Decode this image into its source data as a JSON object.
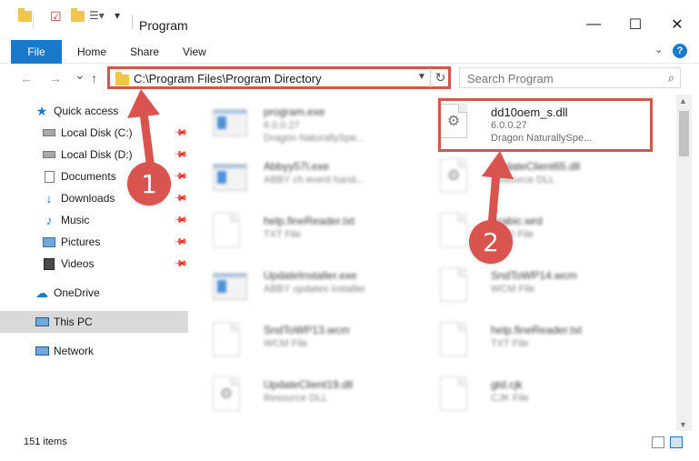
{
  "window": {
    "title": "Program",
    "minimize": "—",
    "maximize": "☐",
    "close": "✕"
  },
  "ribbon": {
    "file": "File",
    "home": "Home",
    "share": "Share",
    "view": "View",
    "help": "?"
  },
  "nav": {
    "back": "←",
    "forward": "→",
    "recent": "⌄",
    "up": "↑",
    "address": "C:\\Program Files\\Program Directory",
    "refresh": "↻",
    "search_placeholder": "Search Program"
  },
  "sidebar": {
    "items": [
      {
        "label": "Quick access",
        "icon": "star-icon",
        "pinned": false
      },
      {
        "label": "Local Disk (C:)",
        "icon": "drive-icon",
        "pinned": true
      },
      {
        "label": "Local Disk (D:)",
        "icon": "drive-icon",
        "pinned": true
      },
      {
        "label": "Documents",
        "icon": "documents-icon",
        "pinned": true
      },
      {
        "label": "Downloads",
        "icon": "download-icon",
        "pinned": true
      },
      {
        "label": "Music",
        "icon": "music-icon",
        "pinned": true
      },
      {
        "label": "Pictures",
        "icon": "pictures-icon",
        "pinned": true
      },
      {
        "label": "Videos",
        "icon": "videos-icon",
        "pinned": true
      },
      {
        "label": "OneDrive",
        "icon": "cloud-icon",
        "pinned": false
      },
      {
        "label": "This PC",
        "icon": "computer-icon",
        "pinned": false,
        "selected": true
      },
      {
        "label": "Network",
        "icon": "network-icon",
        "pinned": false
      }
    ]
  },
  "files": [
    {
      "name": "program.exe",
      "sub1": "6.0.0.27",
      "sub2": "Dragon NaturallySpe...",
      "kind": "exe",
      "blurred": true
    },
    {
      "name": "dd10oem_s.dll",
      "sub1": "6.0.0.27",
      "sub2": "Dragon NaturallySpe...",
      "kind": "dll",
      "blurred": false,
      "highlighted": true
    },
    {
      "name": "Abbyy57l.exe",
      "sub1": "ABBY ch event hand...",
      "sub2": "",
      "kind": "app",
      "blurred": true
    },
    {
      "name": "UpdateClient65.dll",
      "sub1": "Resource DLL",
      "sub2": "",
      "kind": "dll",
      "blurred": true
    },
    {
      "name": "help.fineReader.txt",
      "sub1": "TXT File",
      "sub2": "",
      "kind": "doc",
      "blurred": true
    },
    {
      "name": "Arabic.wrd",
      "sub1": "WRD File",
      "sub2": "",
      "kind": "doc",
      "blurred": true
    },
    {
      "name": "UpdateInstaller.exe",
      "sub1": "ABBY updates installer",
      "sub2": "",
      "kind": "app",
      "blurred": true
    },
    {
      "name": "SndToWP14.wcm",
      "sub1": "WCM File",
      "sub2": "",
      "kind": "doc",
      "blurred": true
    },
    {
      "name": "SndToWP13.wcm",
      "sub1": "WCM File",
      "sub2": "",
      "kind": "doc",
      "blurred": true
    },
    {
      "name": "help.fineReader.txt",
      "sub1": "TXT File",
      "sub2": "",
      "kind": "doc",
      "blurred": true
    },
    {
      "name": "UpdateClient19.dll",
      "sub1": "Resource DLL",
      "sub2": "",
      "kind": "dll",
      "blurred": true
    },
    {
      "name": "gtd.cjk",
      "sub1": "CJK File",
      "sub2": "",
      "kind": "doc",
      "blurred": true
    }
  ],
  "status": {
    "count": "151 items"
  },
  "annotations": {
    "step1": "1",
    "step2": "2"
  },
  "colors": {
    "accent": "#1979ca",
    "annotation": "#d9534f",
    "folder": "#f3c64b"
  }
}
